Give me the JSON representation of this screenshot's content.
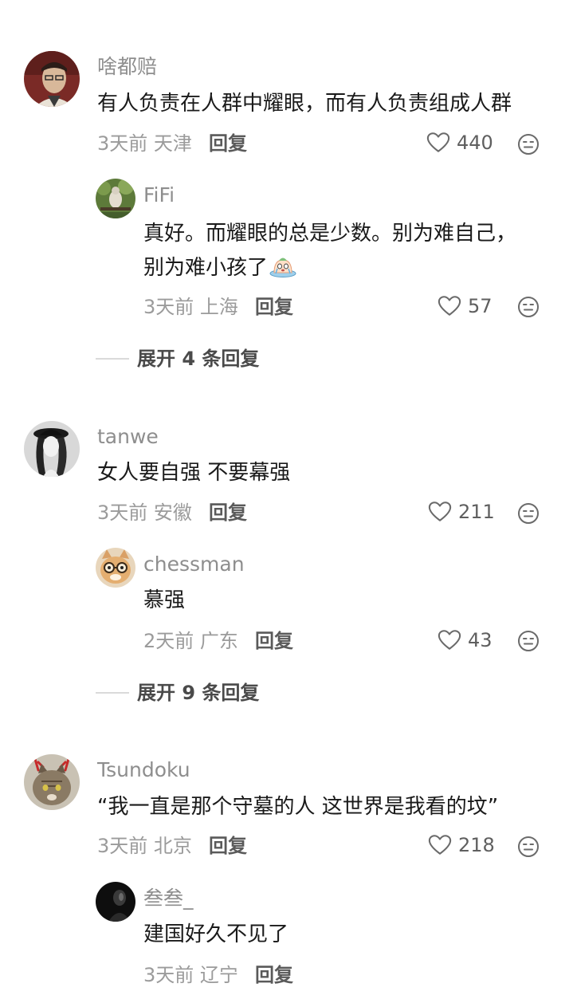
{
  "comments": [
    {
      "username": "啥都赔",
      "text": "有人负责在人群中耀眼，而有人负责组成人群",
      "meta": "3天前 天津",
      "reply_label": "回复",
      "likes": "440",
      "avatar_icon": "portrait-man-glasses",
      "replies": [
        {
          "username": "FiFi",
          "text_line1": "真好。而耀眼的总是少数。别为难自己，",
          "text_line2": "别为难小孩了",
          "inline_emoji": "crying-emoji",
          "meta": "3天前 上海",
          "reply_label": "回复",
          "likes": "57",
          "avatar_icon": "bird-on-branch"
        }
      ],
      "expand_label": "展开 4 条回复"
    },
    {
      "username": "tanwe",
      "text": "女人要自强 不要幕强",
      "meta": "3天前 安徽",
      "reply_label": "回复",
      "likes": "211",
      "avatar_icon": "woman-hat-bw",
      "replies": [
        {
          "username": "chessman",
          "text": "慕强",
          "meta": "2天前 广东",
          "reply_label": "回复",
          "likes": "43",
          "avatar_icon": "cat-glasses"
        }
      ],
      "expand_label": "展开 9 条回复"
    },
    {
      "username": "Tsundoku",
      "text": "“我一直是那个守墓的人 这世界是我看的坟”",
      "meta": "3天前 北京",
      "reply_label": "回复",
      "likes": "218",
      "avatar_icon": "cat-antlers",
      "replies": [
        {
          "username": "叁叁_",
          "text": "建国好久不见了",
          "meta": "3天前 辽宁",
          "reply_label": "回复",
          "avatar_icon": "dark-portrait"
        }
      ]
    }
  ],
  "colors": {
    "username": "#8e8e8e",
    "text": "#1a1a1a",
    "meta": "#9b9b9b",
    "reply": "#5a5a5a",
    "icon": "#6a6a6a"
  }
}
